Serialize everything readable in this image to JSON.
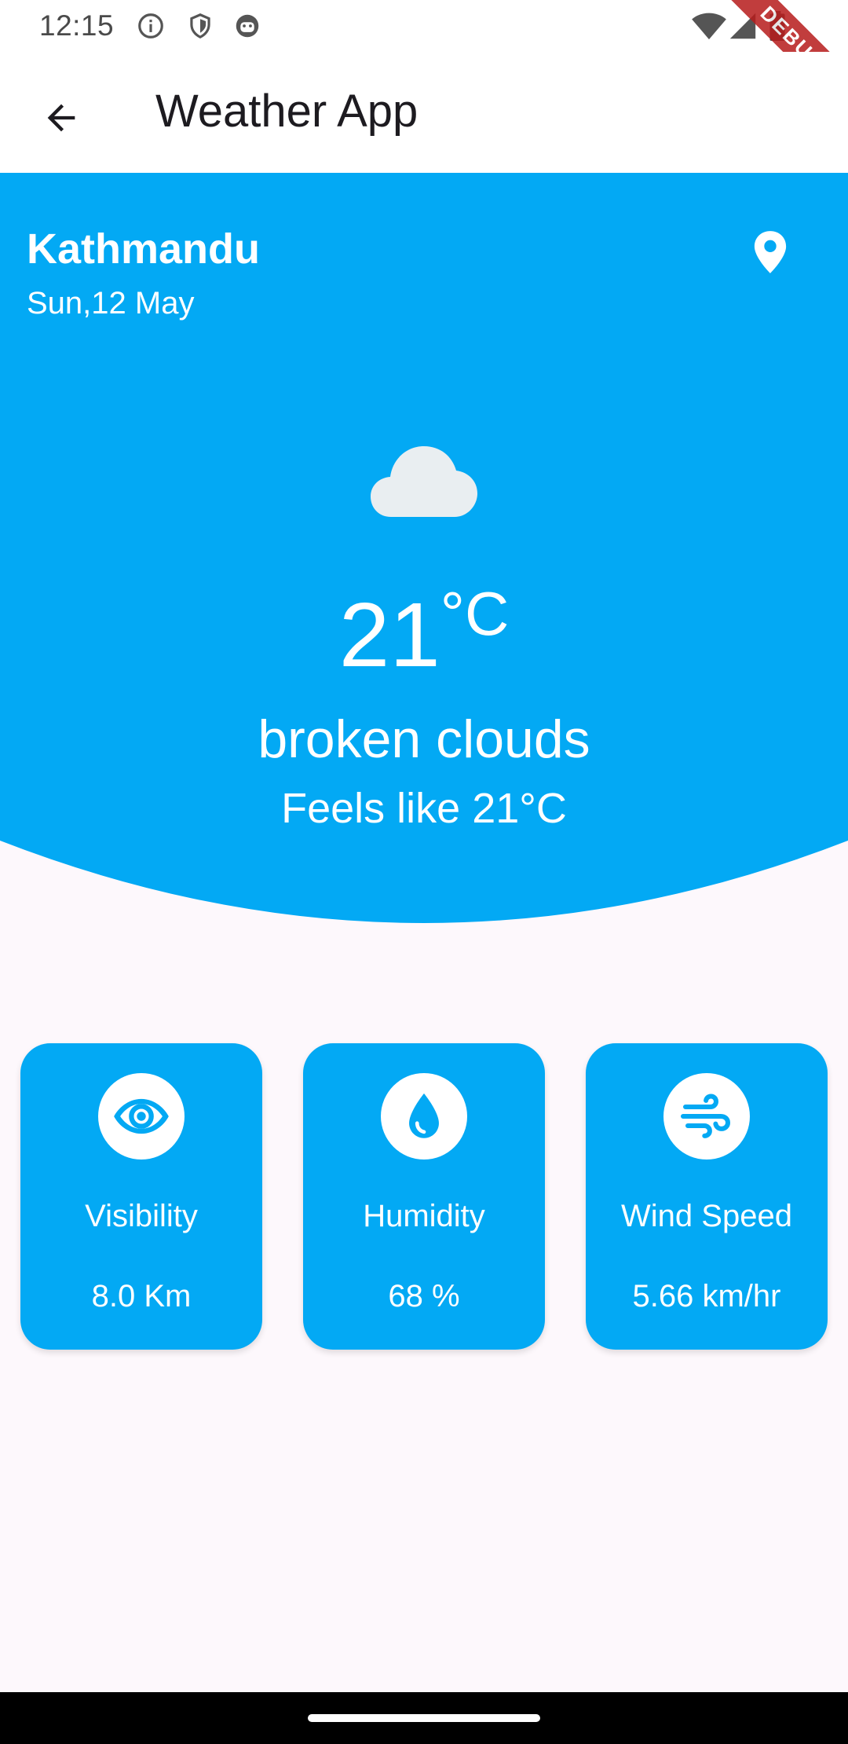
{
  "status_bar": {
    "time": "12:15",
    "icons": [
      "info-icon",
      "shield-icon",
      "android-icon",
      "wifi-icon",
      "signal-icon",
      "battery-icon"
    ]
  },
  "debug_banner": "DEBUG",
  "app_bar": {
    "title": "Weather App",
    "back_icon": "arrow-back-icon"
  },
  "weather": {
    "city": "Kathmandu",
    "date": "Sun,12 May",
    "temperature": "21",
    "unit": "°C",
    "condition": "broken clouds",
    "feels_like": "Feels like 21°C",
    "condition_icon": "cloud-icon",
    "location_icon": "location-pin-icon"
  },
  "metrics": [
    {
      "label": "Visibility",
      "value": "8.0 Km",
      "icon": "eye-icon"
    },
    {
      "label": "Humidity",
      "value": "68 %",
      "icon": "water-drop-icon"
    },
    {
      "label": "Wind Speed",
      "value": "5.66 km/hr",
      "icon": "wind-icon"
    }
  ],
  "colors": {
    "accent": "#03a9f4",
    "background": "#fdf8fc",
    "app_bar": "#ffffff",
    "debug": "#b71c1c"
  }
}
